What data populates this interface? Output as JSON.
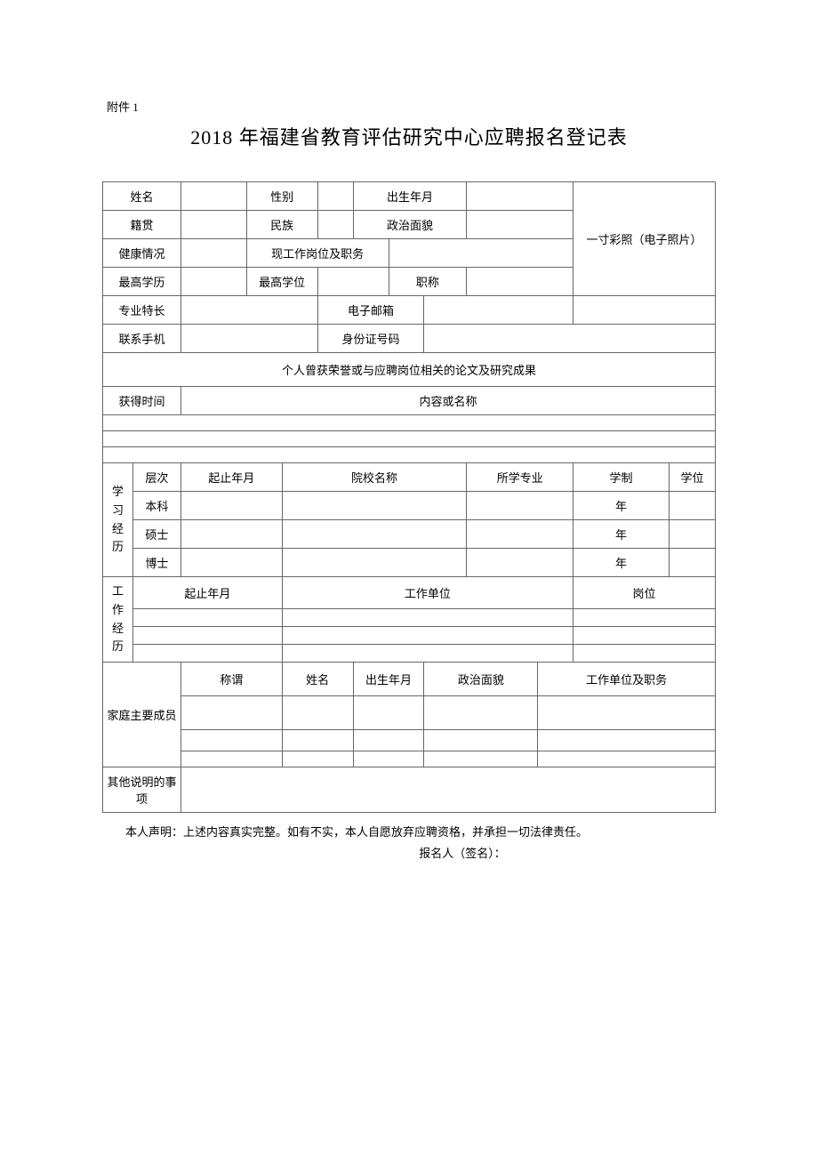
{
  "attachment": "附件 1",
  "title": "2018 年福建省教育评估研究中心应聘报名登记表",
  "labels": {
    "name": "姓名",
    "gender": "性别",
    "birth": "出生年月",
    "origin": "籍贯",
    "ethnic": "民族",
    "political": "政治面貌",
    "health": "健康情况",
    "currentJob": "现工作岗位及职务",
    "photo": "一寸彩照（电子照片）",
    "highestEdu": "最高学历",
    "highestDegree": "最高学位",
    "profTitle": "职称",
    "specialty": "专业特长",
    "email": "电子邮箱",
    "phone": "联系手机",
    "idcard": "身份证号码",
    "honorsHeader": "个人曾获荣誉或与应聘岗位相关的论文及研究成果",
    "gainTime": "获得时间",
    "contentName": "内容或名称",
    "studyHistory": "学 习经 历",
    "level": "层次",
    "startEnd": "起止年月",
    "school": "院校名称",
    "major": "所学专业",
    "schoolSystem": "学制",
    "degree": "学位",
    "undergrad": "本科",
    "master": "硕士",
    "doctor": "博士",
    "yearUnit": "年",
    "workHistory": "工 作经 历",
    "workUnit": "工作单位",
    "post": "岗位",
    "family": "家庭主要成员",
    "relation": "称谓",
    "famName": "姓名",
    "famBirth": "出生年月",
    "famPolitical": "政治面貌",
    "famWork": "工作单位及职务",
    "otherNotes": "其他说明的事项"
  },
  "declaration": {
    "line1": "本人声明：上述内容真实完整。如有不实，本人自愿放弃应聘资格，并承担一切法律责任。",
    "line2": "报名人（签名）："
  }
}
